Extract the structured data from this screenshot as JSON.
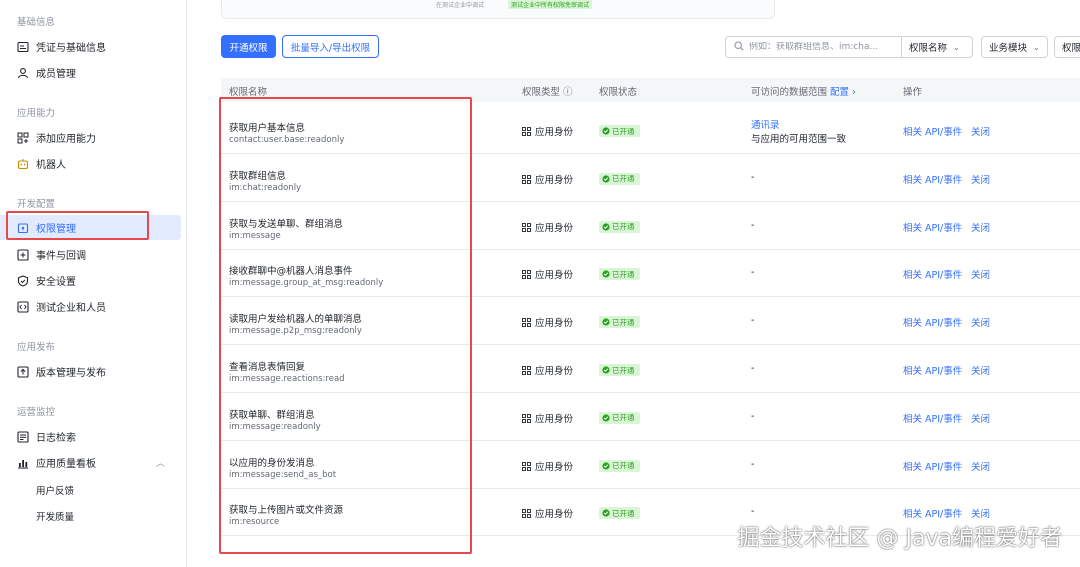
{
  "sidebar": {
    "sections": [
      {
        "title": "基础信息",
        "items": [
          {
            "label": "凭证与基础信息",
            "icon": "doc-icon"
          },
          {
            "label": "成员管理",
            "icon": "user-icon"
          }
        ]
      },
      {
        "title": "应用能力",
        "items": [
          {
            "label": "添加应用能力",
            "icon": "grid-plus-icon"
          },
          {
            "label": "机器人",
            "icon": "robot-icon"
          }
        ]
      },
      {
        "title": "开发配置",
        "items": [
          {
            "label": "权限管理",
            "icon": "lock-icon"
          },
          {
            "label": "事件与回调",
            "icon": "plus-box-icon"
          },
          {
            "label": "安全设置",
            "icon": "shield-icon"
          },
          {
            "label": "测试企业和人员",
            "icon": "code-icon"
          }
        ]
      },
      {
        "title": "应用发布",
        "items": [
          {
            "label": "版本管理与发布",
            "icon": "upload-icon"
          }
        ]
      },
      {
        "title": "运营监控",
        "items": [
          {
            "label": "日志检索",
            "icon": "log-icon"
          },
          {
            "label": "应用质量看板",
            "icon": "chart-icon"
          }
        ]
      }
    ],
    "sub_items": [
      "用户反馈",
      "开发质量"
    ]
  },
  "banner": {
    "text": "在测试企业中调试",
    "badge": "测试企业中所有权限免审调试"
  },
  "toolbar": {
    "open_permission": "开通权限",
    "batch_import_export": "批量导入/导出权限",
    "search_placeholder": "例如：获取群组信息、im:cha...",
    "filter_name": "权限名称",
    "filter_module": "业务模块",
    "filter_more": "权限"
  },
  "table": {
    "headers": {
      "name": "权限名称",
      "type": "权限类型",
      "status": "权限状态",
      "scope": "可访问的数据范围",
      "scope_config": "配置",
      "actions": "操作"
    },
    "rows": [
      {
        "name": "获取用户基本信息",
        "code": "contact:user.base:readonly",
        "type": "应用身份",
        "status": "已开通",
        "scope": "-",
        "scope_link": "通讯录",
        "scope_note": "与应用的可用范围一致",
        "op1": "相关 API/事件",
        "op2": "关闭"
      },
      {
        "name": "获取群组信息",
        "code": "im:chat:readonly",
        "type": "应用身份",
        "status": "已开通",
        "scope": "-",
        "op1": "相关 API/事件",
        "op2": "关闭"
      },
      {
        "name": "获取与发送单聊、群组消息",
        "code": "im:message",
        "type": "应用身份",
        "status": "已开通",
        "scope": "-",
        "op1": "相关 API/事件",
        "op2": "关闭"
      },
      {
        "name": "接收群聊中@机器人消息事件",
        "code": "im:message.group_at_msg:readonly",
        "type": "应用身份",
        "status": "已开通",
        "scope": "-",
        "op1": "相关 API/事件",
        "op2": "关闭"
      },
      {
        "name": "读取用户发给机器人的单聊消息",
        "code": "im:message.p2p_msg:readonly",
        "type": "应用身份",
        "status": "已开通",
        "scope": "-",
        "op1": "相关 API/事件",
        "op2": "关闭"
      },
      {
        "name": "查看消息表情回复",
        "code": "im:message.reactions:read",
        "type": "应用身份",
        "status": "已开通",
        "scope": "-",
        "op1": "相关 API/事件",
        "op2": "关闭"
      },
      {
        "name": "获取单聊、群组消息",
        "code": "im:message:readonly",
        "type": "应用身份",
        "status": "已开通",
        "scope": "-",
        "op1": "相关 API/事件",
        "op2": "关闭"
      },
      {
        "name": "以应用的身份发消息",
        "code": "im:message:send_as_bot",
        "type": "应用身份",
        "status": "已开通",
        "scope": "-",
        "op1": "相关 API/事件",
        "op2": "关闭"
      },
      {
        "name": "获取与上传图片或文件资源",
        "code": "im:resource",
        "type": "应用身份",
        "status": "已开通",
        "scope": "-",
        "op1": "相关 API/事件",
        "op2": "关闭"
      }
    ]
  },
  "watermark": "掘金技术社区 @ Java编程爱好者",
  "colors": {
    "accent": "#3370ff",
    "status_green": "#2ea121",
    "highlight_red": "#e5484d"
  }
}
